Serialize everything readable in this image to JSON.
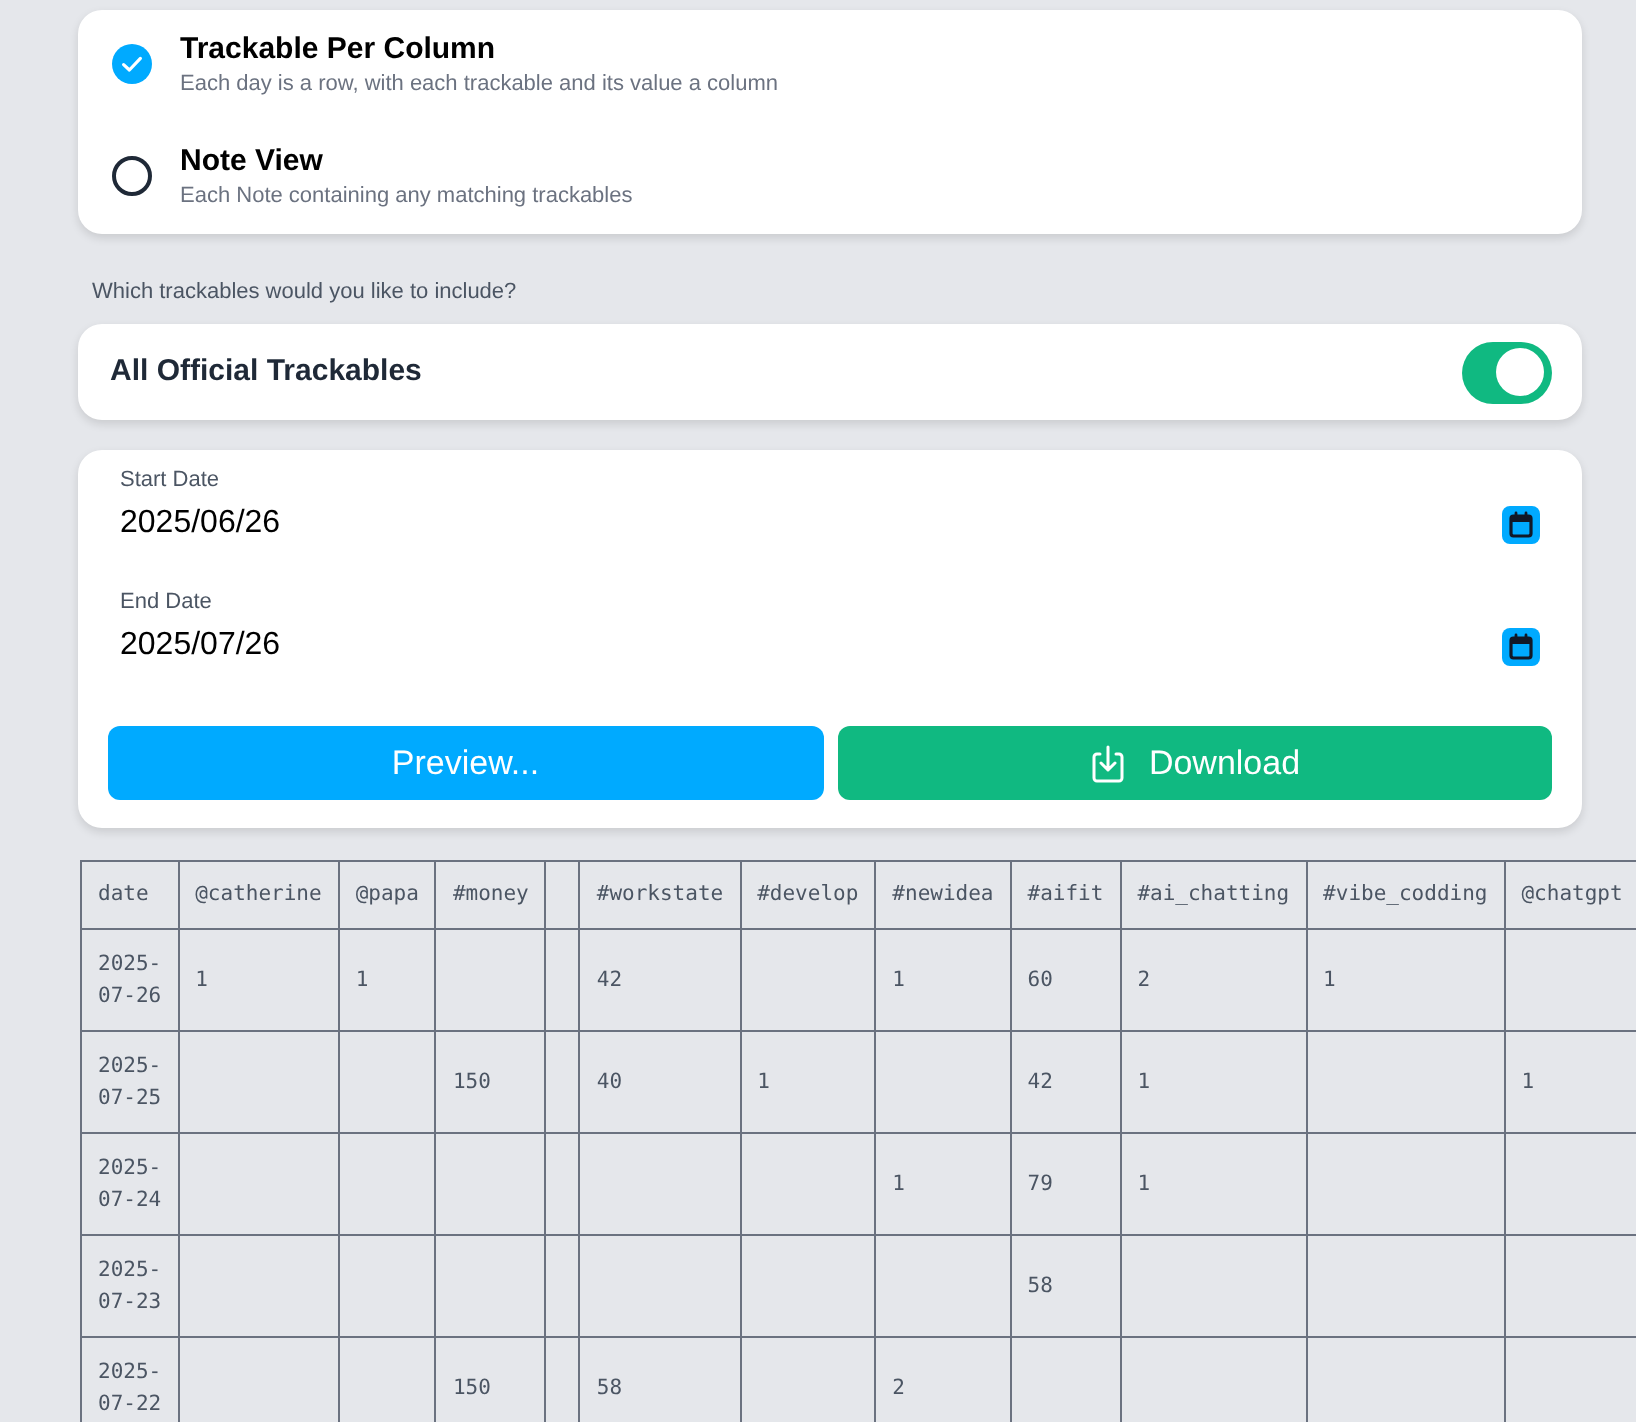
{
  "export_modes": [
    {
      "title": "Trackable Per Column",
      "description": "Each day is a row, with each trackable and its value a column",
      "selected": true
    },
    {
      "title": "Note View",
      "description": "Each Note containing any matching trackables",
      "selected": false
    }
  ],
  "trackables_prompt": "Which trackables would you like to include?",
  "trackables": {
    "label": "All Official Trackables",
    "on": true
  },
  "dates": [
    {
      "label": "Start Date",
      "value": "2025/06/26"
    },
    {
      "label": "End Date",
      "value": "2025/07/26"
    }
  ],
  "buttons": [
    {
      "label": "Preview...",
      "kind": "preview"
    },
    {
      "label": "Download",
      "kind": "download"
    }
  ],
  "table": {
    "columns": [
      "date",
      "@catherine",
      "@papa",
      "#money",
      null,
      "#workstate",
      "#develop",
      "#newidea",
      "#aifit",
      "#ai_chatting",
      "#vibe_codding",
      "@chatgpt"
    ],
    "rows": [
      [
        "2025-07-26",
        "1",
        "1",
        null,
        null,
        "42",
        null,
        "1",
        "60",
        "2",
        "1",
        null
      ],
      [
        "2025-07-25",
        null,
        null,
        "150",
        null,
        "40",
        "1",
        null,
        "42",
        "1",
        null,
        "1"
      ],
      [
        "2025-07-24",
        null,
        null,
        null,
        null,
        null,
        null,
        "1",
        "79",
        "1",
        null,
        null
      ],
      [
        "2025-07-23",
        null,
        null,
        null,
        null,
        null,
        null,
        null,
        "58",
        null,
        null,
        null
      ],
      [
        "2025-07-22",
        null,
        null,
        "150",
        null,
        "58",
        null,
        "2",
        null,
        null,
        null,
        null
      ]
    ]
  }
}
